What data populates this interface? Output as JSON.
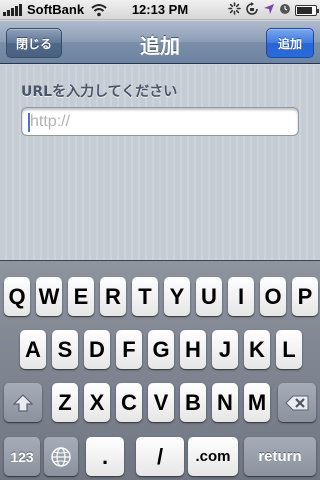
{
  "status_bar": {
    "carrier": "SoftBank",
    "time": "12:13 PM",
    "battery_level": 0.85
  },
  "nav": {
    "title": "追加",
    "left_button": "閉じる",
    "right_button": "追加"
  },
  "form": {
    "prompt": "URLを入力してください",
    "url_value": "",
    "url_placeholder": "http://"
  },
  "keyboard": {
    "row1": [
      "Q",
      "W",
      "E",
      "R",
      "T",
      "Y",
      "U",
      "I",
      "O",
      "P"
    ],
    "row2": [
      "A",
      "S",
      "D",
      "F",
      "G",
      "H",
      "J",
      "K",
      "L"
    ],
    "row3": [
      "Z",
      "X",
      "C",
      "V",
      "B",
      "N",
      "M"
    ],
    "numbers_key": "123",
    "dot_key": ".",
    "slash_key": "/",
    "dotcom_key": ".com",
    "return_key": "return"
  },
  "icons": {
    "signal": "signal-bars-icon",
    "wifi": "wifi-icon",
    "activity": "activity-spinner-icon",
    "rotation_lock": "rotation-lock-icon",
    "location": "location-arrow-icon",
    "alarm": "alarm-icon",
    "battery": "battery-icon",
    "shift": "shift-arrow-icon",
    "delete": "delete-backspace-icon",
    "globe": "globe-icon"
  }
}
